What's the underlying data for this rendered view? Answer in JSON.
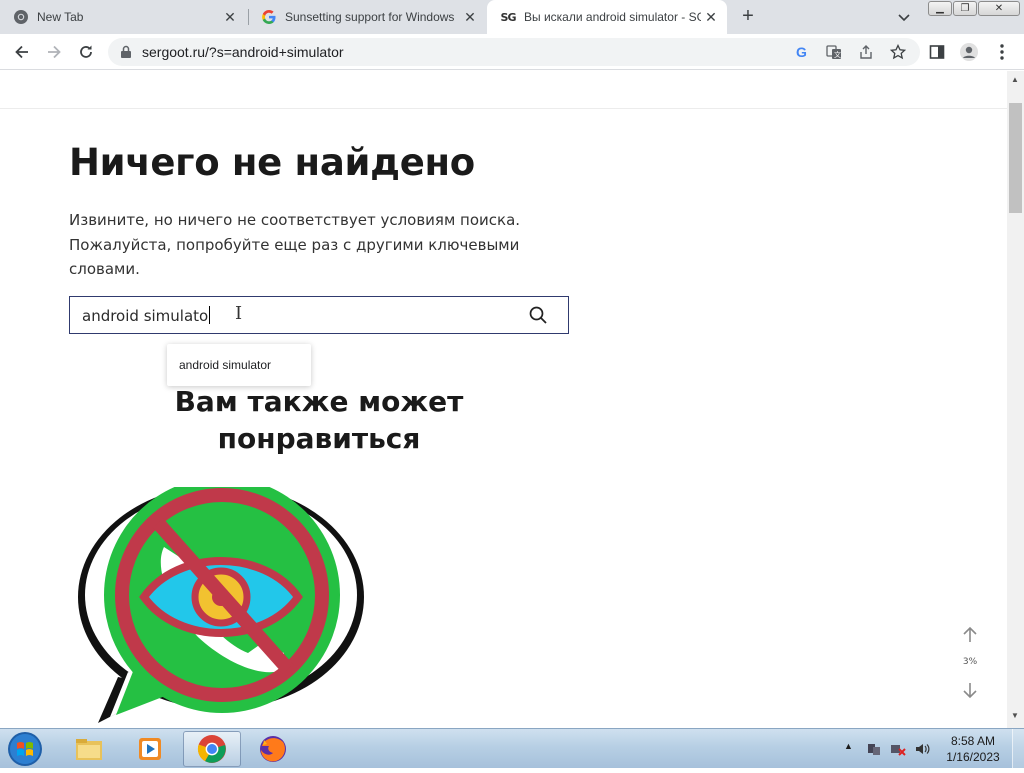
{
  "browser": {
    "tabs": [
      {
        "title": "New Tab",
        "icon": "chrome-icon",
        "active": false
      },
      {
        "title": "Sunsetting support for Windows",
        "icon": "google-icon",
        "active": false
      },
      {
        "title": "Вы искали android simulator - SG",
        "icon": "sg-logo-icon",
        "favicon_text": "SG",
        "active": true
      }
    ],
    "url": "sergoot.ru/?s=android+simulator"
  },
  "page": {
    "heading": "Ничего не найдено",
    "message": "Извините, но ничего не соответствует условиям поиска. Пожалуйста, попробуйте еще раз с другими ключевыми словами.",
    "search": {
      "value": "android simulato",
      "suggestion": "android simulator"
    },
    "related_title": "Вам также может понравиться",
    "scroll_percent": "3%"
  },
  "taskbar": {
    "apps": [
      "windows-explorer-icon",
      "media-player-icon",
      "chrome-icon",
      "firefox-icon"
    ],
    "clock_time": "8:58 AM",
    "clock_date": "1/16/2023"
  },
  "colors": {
    "tab_strip": "#dee1e6",
    "search_border": "#303a6e",
    "whatsapp_green": "#25c043",
    "prohibition_red": "#c0394a",
    "eye_blue": "#22c7ea"
  }
}
